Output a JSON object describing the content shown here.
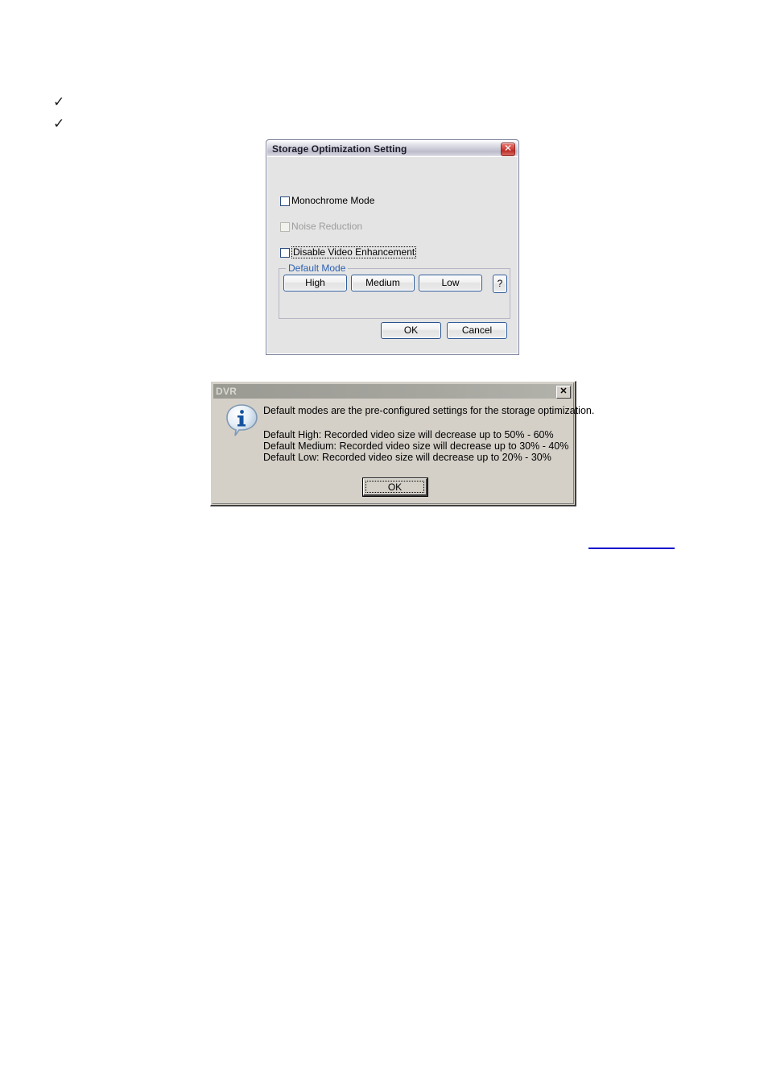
{
  "page": {
    "bullets": [
      "✓",
      "✓"
    ],
    "footer_link_text": ""
  },
  "storage_dialog": {
    "title": "Storage Optimization Setting",
    "close_label": "✕",
    "checkboxes": [
      {
        "label": "Monochrome Mode",
        "checked": false,
        "enabled": true,
        "focused": false
      },
      {
        "label": "Noise Reduction",
        "checked": false,
        "enabled": false,
        "focused": false
      },
      {
        "label": "Disable Video Enhancement",
        "checked": false,
        "enabled": true,
        "focused": true
      }
    ],
    "group": {
      "legend": "Default Mode",
      "legend_color": "#2b5fb0",
      "buttons": [
        {
          "label": "High"
        },
        {
          "label": "Medium"
        },
        {
          "label": "Low"
        },
        {
          "label": "?"
        }
      ]
    },
    "ok_label": "OK",
    "cancel_label": "Cancel"
  },
  "dvr_dialog": {
    "title": "DVR",
    "close_label": "✕",
    "icon": "info-icon",
    "headline": "Default modes are the pre-configured settings for the storage optimization.",
    "lines": [
      "Default High: Recorded video size will decrease up to 50% - 60%",
      "Default Medium: Recorded video size will decrease up to 30% - 40%",
      "Default Low: Recorded video size will decrease up to 20% - 30%"
    ],
    "ok_label": "OK"
  }
}
